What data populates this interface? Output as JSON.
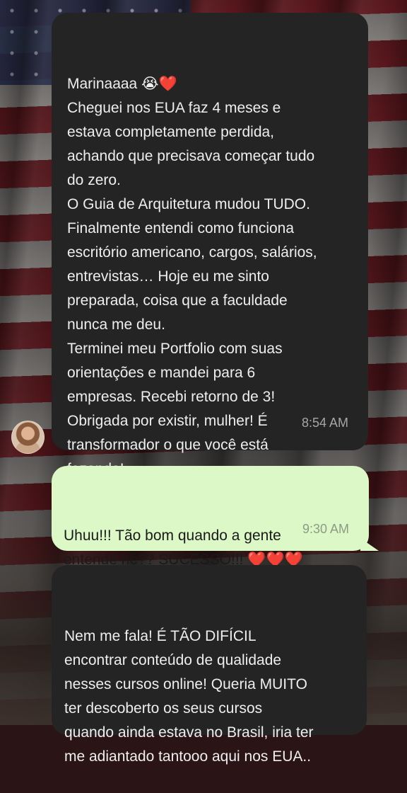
{
  "messages": [
    {
      "direction": "incoming",
      "lines": [
        "Marinaaaa 😭❤️",
        "Cheguei nos EUA faz 4 meses e",
        "estava completamente perdida,",
        "achando que precisava começar tudo",
        "do zero.",
        "O Guia de Arquitetura mudou TUDO.",
        "Finalmente entendi como funciona",
        "escritório americano, cargos, salários,",
        "entrevistas… Hoje eu me sinto",
        "preparada, coisa que a faculdade",
        "nunca me deu.",
        "Terminei meu Portfolio com suas",
        "orientações e mandei para 6",
        "empresas. Recebi retorno de 3!",
        "Obrigada por existir, mulher! É",
        "transformador o que você está",
        "fazendo!"
      ],
      "time": "8:54 AM"
    },
    {
      "direction": "outgoing",
      "lines": [
        "Uhuu!!! Tão bom quando a gente",
        "entende né?? SUCESSO!!! ❤️❤️❤️"
      ],
      "time": "9:30 AM"
    },
    {
      "direction": "incoming",
      "lines": [
        "Nem me fala! É TÃO DIFÍCIL",
        "encontrar conteúdo de qualidade",
        "nesses cursos online! Queria MUITO",
        "ter descoberto os seus cursos",
        "quando ainda estava no Brasil, iria ter",
        "me adiantado tantooo aqui nos EUA.."
      ],
      "time": ""
    }
  ],
  "colors": {
    "incoming_bubble": "#242424",
    "outgoing_bubble": "#dcf8c6",
    "incoming_text": "#eeeeee",
    "outgoing_text": "#1a1a1a"
  },
  "icons": {
    "avatar": "contact-avatar"
  }
}
